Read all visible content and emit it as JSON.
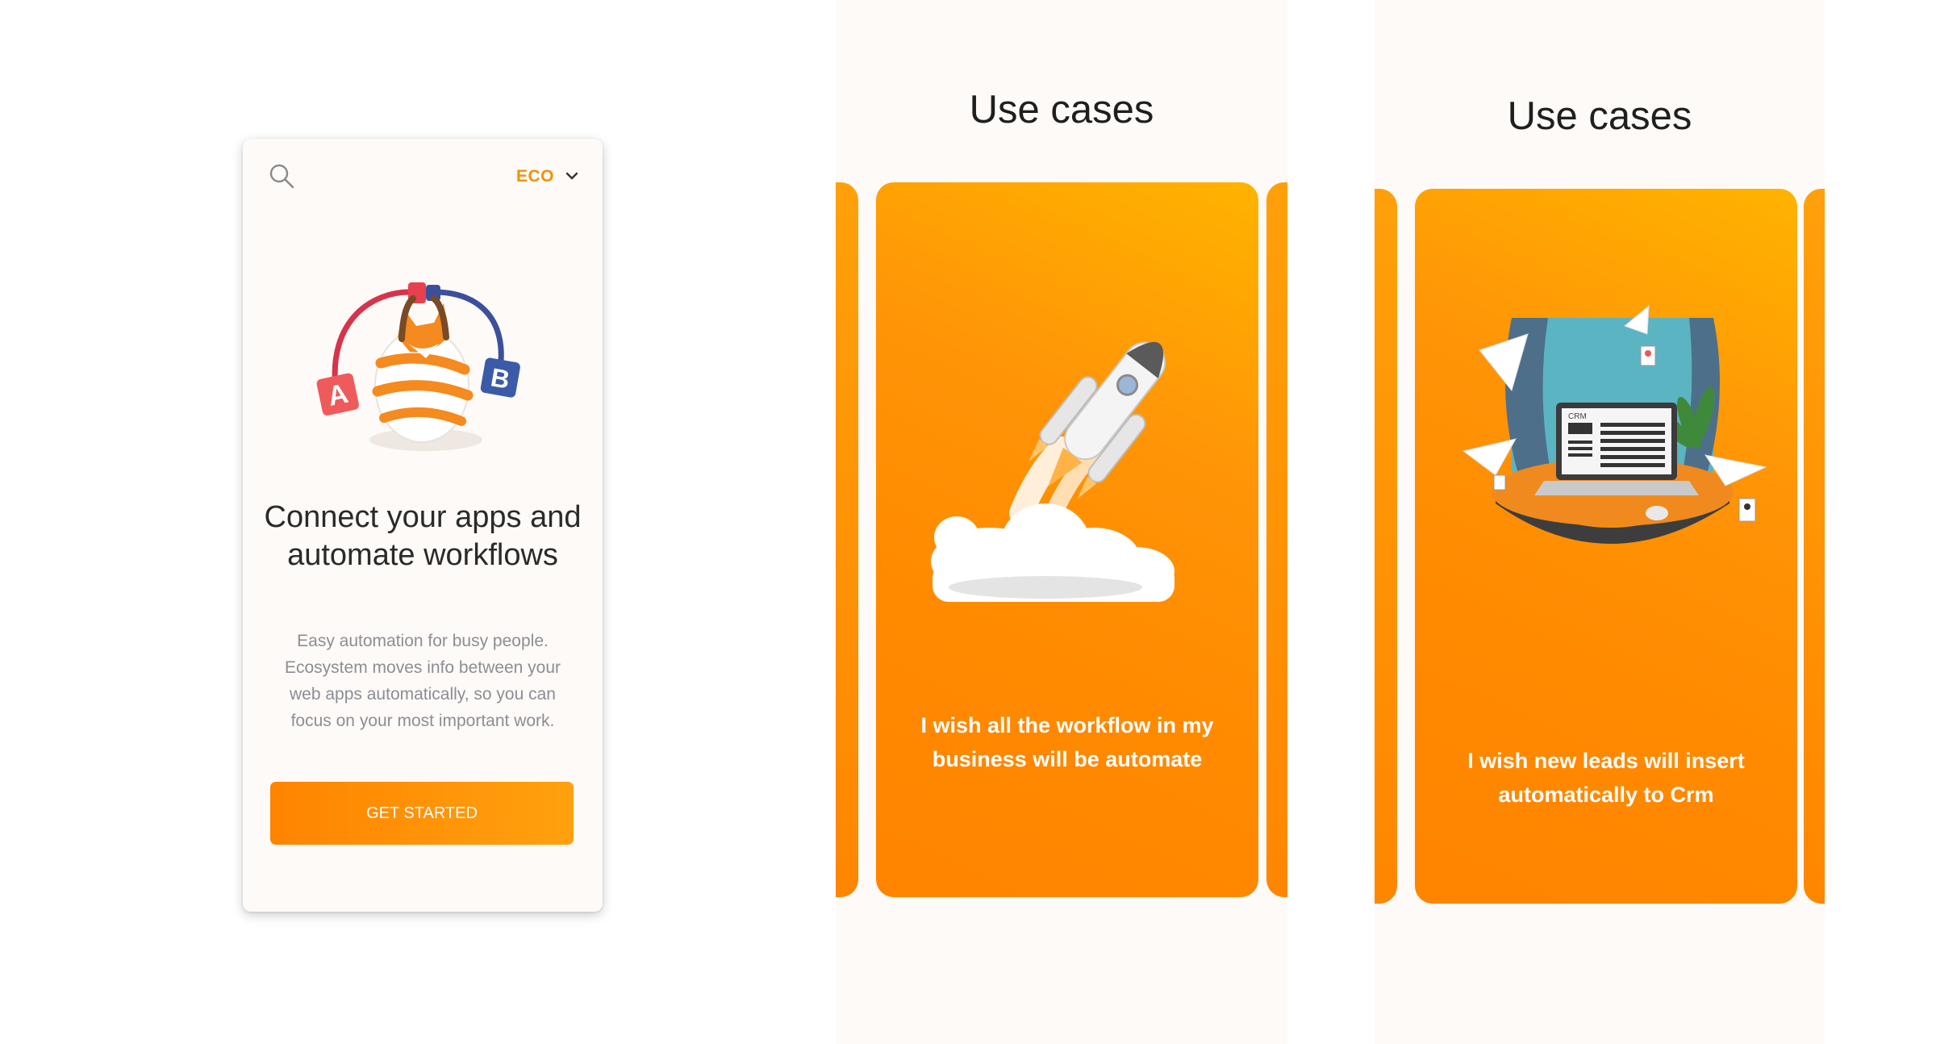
{
  "onboarding": {
    "language": "ECO",
    "title": "Connect your apps and automate workflows",
    "description": "Easy automation for busy people. Ecosystem moves info between your web apps automatically, so you can focus on your most important work.",
    "cta_label": "GET STARTED",
    "illustration": {
      "left_block": "A",
      "right_block": "B"
    },
    "icons": [
      "search-icon",
      "chevron-down-icon",
      "fox-connector-illustration"
    ]
  },
  "use_cases_1": {
    "heading": "Use cases",
    "caption": "I wish all the workflow in my business will be automate",
    "illustration": "rocket-launch-illustration"
  },
  "use_cases_2": {
    "heading": "Use cases",
    "caption": "I wish new leads will insert automatically to Crm",
    "illustration": "laptop-crm-illustration",
    "laptop_label": "CRM"
  },
  "colors": {
    "accent": "#ff8c00",
    "accent_light": "#ffb300",
    "background": "#fdfaf7",
    "muted_text": "#8c8e96",
    "block_a": "#ef5a5a",
    "block_b": "#3b5ba8"
  }
}
